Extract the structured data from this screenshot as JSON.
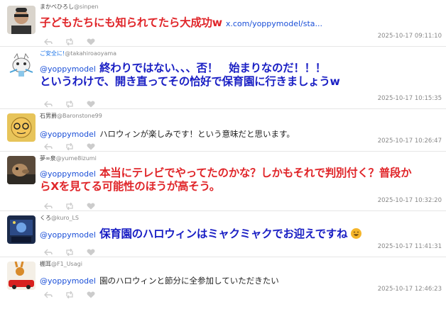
{
  "posts": [
    {
      "name": "まかべひろし",
      "handle": "@sinpen",
      "text": "子どもたちにも知られてたら大成功w",
      "link": "x.com/yoppymodel/sta...",
      "timestamp": "2025-10-17 09:11:10"
    },
    {
      "name": "ご安全に!",
      "handle": "@takahiroaoyama",
      "mention": "@yoppymodel",
      "text_line1": "終わりではない、、、否！　始まりなのだ！！！",
      "text_line2": "というわけで、開き直ってその恰好で保育園に行きましょうw",
      "timestamp": "2025-10-17 10:15:35"
    },
    {
      "name": "石男爵",
      "handle": "@Baronstone99",
      "mention": "@yoppymodel",
      "text": "ハロウィンが楽しみです！という意味だと思います。",
      "timestamp": "2025-10-17 10:26:47"
    },
    {
      "name": "夢∞泉",
      "handle": "@yume8izumi",
      "mention": "@yoppymodel",
      "text_line1": "本当にテレビでやってたのかな？しかもそれで判別付く？普段か",
      "text_line2": "らXを見てる可能性のほうが高そう。",
      "timestamp": "2025-10-17 10:32:20"
    },
    {
      "name": "くろ",
      "handle": "@kuro_LS",
      "mention": "@yoppymodel",
      "text": "保育園のハロウィンはミャクミャクでお迎えですね",
      "timestamp": "2025-10-17 11:41:31"
    },
    {
      "name": "棚耳",
      "handle": "@F1_Usagi",
      "mention": "@yoppymodel",
      "text": "園のハロウィンと節分に全参加していただきたい",
      "timestamp": "2025-10-17 12:46:23"
    }
  ],
  "icons": {
    "reply": "reply-icon",
    "retweet": "retweet-icon",
    "like": "heart-icon",
    "emoji": "grinning-face-emoji"
  },
  "colors": {
    "red_text": "#e0262a",
    "blue_text": "#1a1fc4",
    "mention": "#1a4fd8",
    "timestamp": "#888888"
  }
}
